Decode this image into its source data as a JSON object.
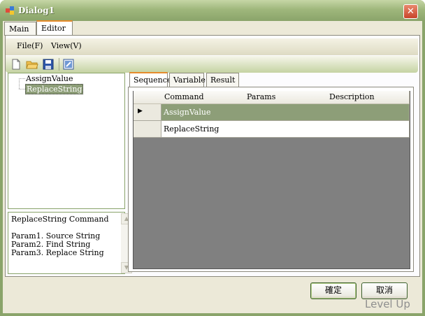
{
  "window": {
    "title": "Dialog1"
  },
  "tabs": [
    {
      "label": "Main"
    },
    {
      "label": "Editor"
    }
  ],
  "menu": [
    {
      "label": "File(F)"
    },
    {
      "label": "View(V)"
    }
  ],
  "toolbar": [
    {
      "icon": "new-file-icon"
    },
    {
      "icon": "open-folder-icon"
    },
    {
      "icon": "save-icon"
    },
    {
      "icon": "properties-icon"
    }
  ],
  "tree": {
    "items": [
      {
        "label": "AssignValue"
      },
      {
        "label": "ReplaceString",
        "selected": true
      }
    ]
  },
  "help": {
    "lines": [
      "ReplaceString Command",
      "",
      "Param1. Source String",
      "Param2. Find String",
      "Param3. Replace String"
    ]
  },
  "inner_tabs": [
    {
      "label": "Sequence"
    },
    {
      "label": "Variable"
    },
    {
      "label": "Result"
    }
  ],
  "grid": {
    "columns": [
      "Command",
      "Params",
      "Description"
    ],
    "rows": [
      {
        "command": "AssignValue",
        "params": "",
        "description": "",
        "selected": true
      },
      {
        "command": "ReplaceString",
        "params": "",
        "description": ""
      }
    ],
    "row_indicator": "▶"
  },
  "buttons": {
    "ok": "確定",
    "cancel": "取消"
  },
  "watermark": "Level Up",
  "colors": {
    "accent": "#8aa46a",
    "selection": "#8d9e78",
    "tab_highlight": "#e68b2c"
  }
}
